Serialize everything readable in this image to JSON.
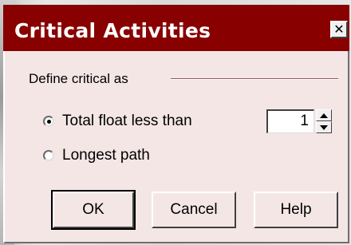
{
  "window": {
    "title": "Critical Activities",
    "close_icon": "close-icon",
    "title_bar_color": "#880000",
    "body_color": "#f5e6e6"
  },
  "group": {
    "label": "Define critical as"
  },
  "options": [
    {
      "label": "Total float less than",
      "checked": true
    },
    {
      "label": "Longest path",
      "checked": false
    }
  ],
  "float_threshold": {
    "value": "1"
  },
  "buttons": {
    "ok": "OK",
    "cancel": "Cancel",
    "help": "Help"
  }
}
